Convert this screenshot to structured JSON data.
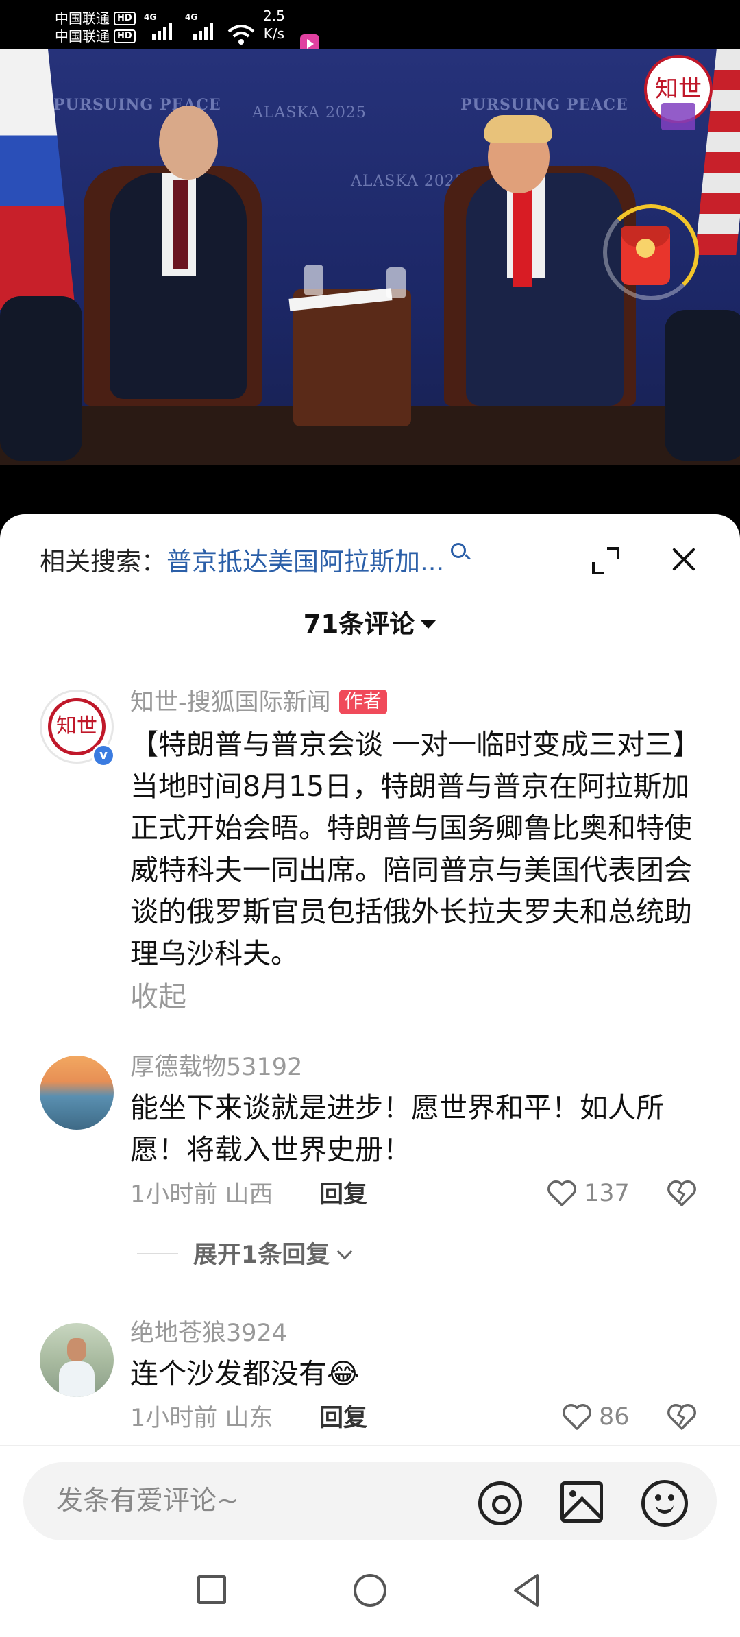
{
  "status_bar": {
    "carrier_1": "中国联通",
    "carrier_2": "中国联通",
    "hd_label": "HD",
    "network_type": "4G",
    "net_speed_value": "2.5",
    "net_speed_unit": "K/s"
  },
  "video": {
    "backdrop_texts": [
      "PURSUING PEACE",
      "ALASKA 2025",
      "ALASKA 2025",
      "PURSUING PEACE"
    ],
    "channel_logo_text": "知世",
    "red_packet": "red-packet-icon"
  },
  "sheet": {
    "related_label": "相关搜索：",
    "related_query": "普京抵达美国阿拉斯加...",
    "comment_count": "71条评论",
    "input_placeholder": "发条有爱评论~"
  },
  "comments": [
    {
      "username": "知世-搜狐国际新闻",
      "author_tag": "作者",
      "avatar_text": "知世",
      "verified": "v",
      "text": "【特朗普与普京会谈 一对一临时变成三对三】当地时间8月15日，特朗普与普京在阿拉斯加正式开始会晤。特朗普与国务卿鲁比奥和特使威特科夫一同出席。陪同普京与美国代表团会谈的俄罗斯官员包括俄外长拉夫罗夫和总统助理乌沙科夫。",
      "collapse_label": "收起"
    },
    {
      "username": "厚德载物53192",
      "text": "能坐下来谈就是进步！愿世界和平！如人所愿！将载入世界史册！",
      "time": "1小时前",
      "location": "山西",
      "reply_label": "回复",
      "likes": "137",
      "expand_label": "展开1条回复"
    },
    {
      "username": "绝地苍狼3924",
      "text": "连个沙发都没有😂",
      "time": "1小时前",
      "location": "山东",
      "reply_label": "回复",
      "likes": "86"
    }
  ],
  "icons": {
    "search": "search-icon",
    "expand": "expand-icon",
    "close": "close-icon",
    "at": "at-icon",
    "image": "image-icon",
    "emoji": "emoji-icon",
    "like": "heart-icon",
    "dislike": "broken-heart-icon"
  },
  "colors": {
    "link_blue": "#2b5fa8",
    "author_tag": "#f04a5a",
    "muted_text": "#999999"
  }
}
